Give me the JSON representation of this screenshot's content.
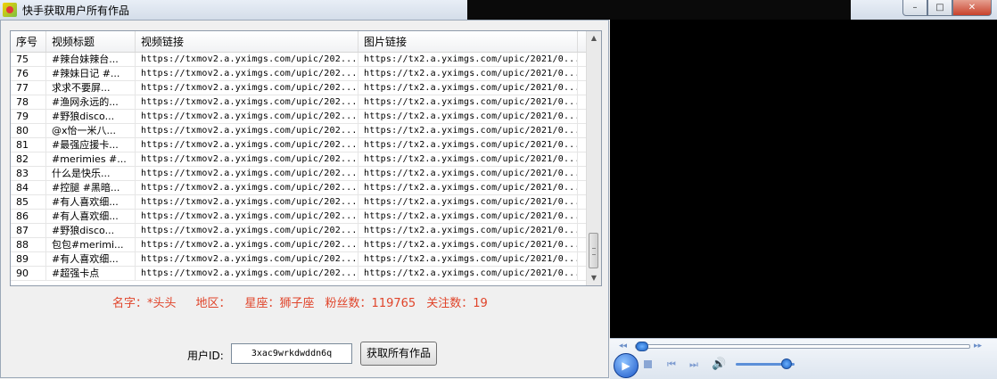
{
  "window": {
    "title": "快手获取用户所有作品",
    "minimize_glyph": "–",
    "maximize_glyph": "□",
    "close_glyph": "✕"
  },
  "table": {
    "headers": [
      "序号",
      "视频标题",
      "视频链接",
      "图片链接"
    ],
    "rows": [
      [
        "75",
        "#辣台妹辣台...",
        "https://txmov2.a.yximgs.com/upic/202...",
        "https://tx2.a.yximgs.com/upic/2021/0..."
      ],
      [
        "76",
        "#辣妹日记 #...",
        "https://txmov2.a.yximgs.com/upic/202...",
        "https://tx2.a.yximgs.com/upic/2021/0..."
      ],
      [
        "77",
        "求求不要屏...",
        "https://txmov2.a.yximgs.com/upic/202...",
        "https://tx2.a.yximgs.com/upic/2021/0..."
      ],
      [
        "78",
        "#渔网永远的...",
        "https://txmov2.a.yximgs.com/upic/202...",
        "https://tx2.a.yximgs.com/upic/2021/0..."
      ],
      [
        "79",
        "#野狼disco...",
        "https://txmov2.a.yximgs.com/upic/202...",
        "https://tx2.a.yximgs.com/upic/2021/0..."
      ],
      [
        "80",
        "@x怡一米八...",
        "https://txmov2.a.yximgs.com/upic/202...",
        "https://tx2.a.yximgs.com/upic/2021/0..."
      ],
      [
        "81",
        "#最强应援卡...",
        "https://txmov2.a.yximgs.com/upic/202...",
        "https://tx2.a.yximgs.com/upic/2021/0..."
      ],
      [
        "82",
        "#merimies #...",
        "https://txmov2.a.yximgs.com/upic/202...",
        "https://tx2.a.yximgs.com/upic/2021/0..."
      ],
      [
        "83",
        "什么是快乐...",
        "https://txmov2.a.yximgs.com/upic/202...",
        "https://tx2.a.yximgs.com/upic/2021/0..."
      ],
      [
        "84",
        "#控腿 #黑暗...",
        "https://txmov2.a.yximgs.com/upic/202...",
        "https://tx2.a.yximgs.com/upic/2021/0..."
      ],
      [
        "85",
        "#有人喜欢细...",
        "https://txmov2.a.yximgs.com/upic/202...",
        "https://tx2.a.yximgs.com/upic/2021/0..."
      ],
      [
        "86",
        "#有人喜欢细...",
        "https://txmov2.a.yximgs.com/upic/202...",
        "https://tx2.a.yximgs.com/upic/2021/0..."
      ],
      [
        "87",
        "#野狼disco...",
        "https://txmov2.a.yximgs.com/upic/202...",
        "https://tx2.a.yximgs.com/upic/2021/0..."
      ],
      [
        "88",
        "包包#merimi...",
        "https://txmov2.a.yximgs.com/upic/202...",
        "https://tx2.a.yximgs.com/upic/2021/0..."
      ],
      [
        "89",
        "#有人喜欢细...",
        "https://txmov2.a.yximgs.com/upic/202...",
        "https://tx2.a.yximgs.com/upic/2021/0..."
      ],
      [
        "90",
        "#超强卡点",
        "https://txmov2.a.yximgs.com/upic/202...",
        "https://tx2.a.yximgs.com/upic/2021/0..."
      ]
    ],
    "scroll_up_glyph": "▲",
    "scroll_down_glyph": "▼"
  },
  "profile": {
    "name": "名字：*头头",
    "region": "地区：",
    "constellation": "星座：狮子座",
    "fans": "粉丝数：119765",
    "follows": "关注数：19",
    "color": "#e0442a"
  },
  "form": {
    "uid_label": "用户ID:",
    "uid_value": "3xac9wrkdwddn6q",
    "fetch_button": "获取所有作品"
  },
  "player": {
    "play_glyph": "▶",
    "prev_glyph": "⏮",
    "next_glyph": "⏭",
    "volume_glyph": "🔊",
    "skip_back_glyph": "◂◂",
    "skip_fwd_glyph": "▸▸",
    "volume_level": 0.85,
    "seek_position": 0.0
  }
}
